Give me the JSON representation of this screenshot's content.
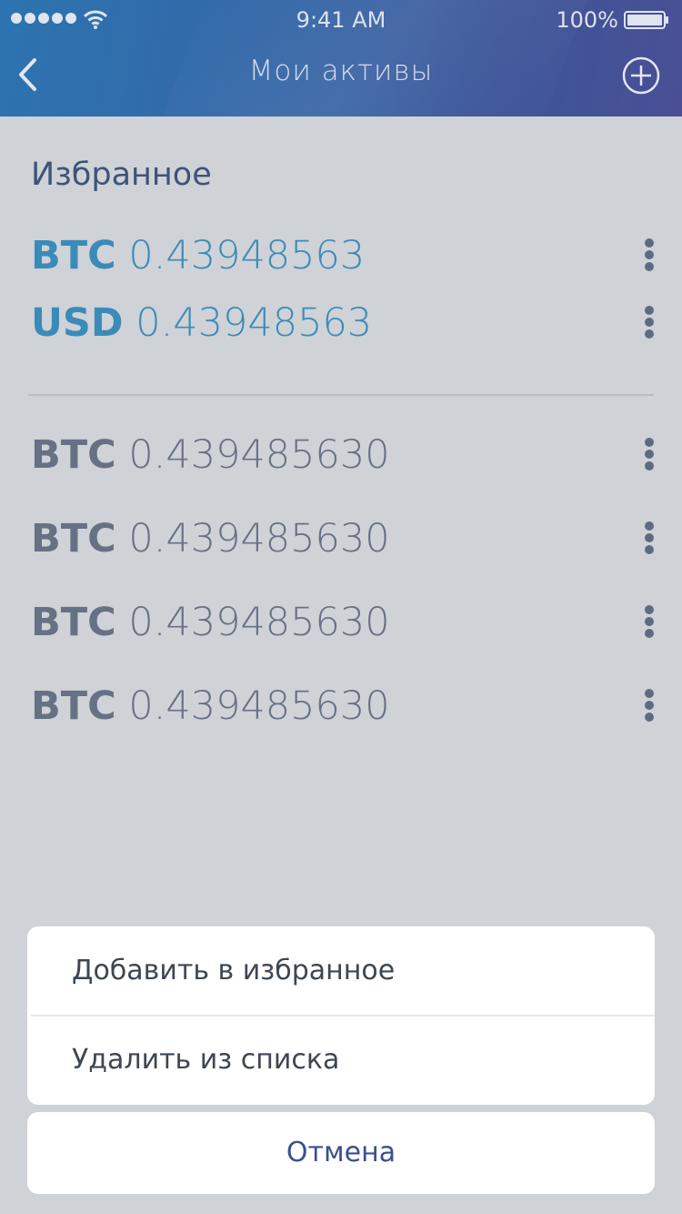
{
  "status_bar": {
    "time": "9:41 AM",
    "battery": "100%"
  },
  "nav": {
    "title": "Мои активы",
    "back_icon": "chevron-left-icon",
    "add_icon": "plus-circle-icon"
  },
  "favorites": {
    "title": "Избранное",
    "items": [
      {
        "code": "BTC",
        "amount": "0.43948563"
      },
      {
        "code": "USD",
        "amount": "0.43948563"
      }
    ]
  },
  "assets": [
    {
      "code": "BTC",
      "amount": "0.439485630"
    },
    {
      "code": "BTC",
      "amount": "0.439485630"
    },
    {
      "code": "BTC",
      "amount": "0.439485630"
    },
    {
      "code": "BTC",
      "amount": "0.439485630"
    }
  ],
  "action_sheet": {
    "add_favorite": "Добавить в избранное",
    "remove": "Удалить из списка",
    "cancel": "Отмена"
  },
  "colors": {
    "header_start": "#2c74b0",
    "header_end": "#4a4f95",
    "favorite_text": "#3b8bb8",
    "asset_text": "#667184",
    "cancel_text": "#3b5090"
  }
}
